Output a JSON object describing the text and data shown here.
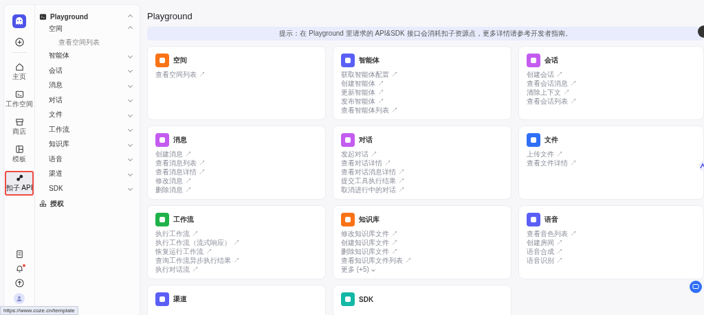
{
  "rail": {
    "items": [
      {
        "label": "主页",
        "selected": false
      },
      {
        "label": "工作空间",
        "selected": false
      },
      {
        "label": "商店",
        "selected": false
      },
      {
        "label": "模板",
        "selected": false
      },
      {
        "label": "扣子 API",
        "selected": true
      }
    ],
    "notification_dot": true
  },
  "nav": {
    "header": {
      "label": "Playground",
      "expanded": true
    },
    "items": [
      {
        "label": "空间",
        "expanded": true,
        "children": [
          {
            "label": "查看空间列表"
          }
        ]
      },
      {
        "label": "智能体",
        "expanded": false
      },
      {
        "label": "会话",
        "expanded": false
      },
      {
        "label": "消息",
        "expanded": false
      },
      {
        "label": "对话",
        "expanded": false
      },
      {
        "label": "文件",
        "expanded": false
      },
      {
        "label": "工作流",
        "expanded": false
      },
      {
        "label": "知识库",
        "expanded": false
      },
      {
        "label": "语音",
        "expanded": false
      },
      {
        "label": "渠道",
        "expanded": false
      },
      {
        "label": "SDK",
        "expanded": false
      }
    ],
    "auth": {
      "label": "授权"
    }
  },
  "main": {
    "title": "Playground",
    "notice": "提示：在 Playground 里请求的 API&SDK 接口会消耗扣子资源点，更多详情请参考开发者指南。",
    "cards": [
      {
        "title": "空间",
        "color": "#f97316",
        "links": [
          "查看空间列表 ↗"
        ]
      },
      {
        "title": "智能体",
        "color": "#5b5ff5",
        "links": [
          "获取智能体配置 ↗",
          "创建智能体 ↗",
          "更新智能体 ↗",
          "发布智能体 ↗",
          "查看智能体列表 ↗"
        ]
      },
      {
        "title": "会话",
        "color": "#c45cf0",
        "links": [
          "创建会话 ↗",
          "查看会话消息 ↗",
          "清除上下文 ↗",
          "查看会话列表 ↗"
        ]
      },
      {
        "title": "消息",
        "color": "#c45cf0",
        "links": [
          "创建消息 ↗",
          "查看消息列表 ↗",
          "查看消息详情 ↗",
          "修改消息 ↗",
          "删除消息 ↗"
        ]
      },
      {
        "title": "对话",
        "color": "#c45cf0",
        "links": [
          "发起对话 ↗",
          "查看对话详情 ↗",
          "查看对话消息详情 ↗",
          "提交工具执行结果 ↗",
          "取消进行中的对话 ↗"
        ]
      },
      {
        "title": "文件",
        "color": "#2f6ff5",
        "links": [
          "上传文件 ↗",
          "查看文件详情 ↗"
        ]
      },
      {
        "title": "工作流",
        "color": "#1fb24a",
        "links": [
          "执行工作流 ↗",
          "执行工作流（流式响应） ↗",
          "恢复运行工作流 ↗",
          "查询工作流异步执行结果 ↗",
          "执行对话流 ↗"
        ]
      },
      {
        "title": "知识库",
        "color": "#f97316",
        "links": [
          "修改知识库文件 ↗",
          "创建知识库文件 ↗",
          "删除知识库文件 ↗",
          "查看知识库文件列表 ↗"
        ],
        "more": "更多 (+5)"
      },
      {
        "title": "语音",
        "color": "#5b5ff5",
        "links": [
          "查看音色列表 ↗",
          "创建房间 ↗",
          "语音合成 ↗",
          "语音识别 ↗"
        ]
      },
      {
        "title": "渠道",
        "color": "#5b5ff5"
      },
      {
        "title": "SDK",
        "color": "#14b8a6"
      }
    ]
  },
  "status_bar": {
    "url": "https://www.coze.cn/template"
  }
}
